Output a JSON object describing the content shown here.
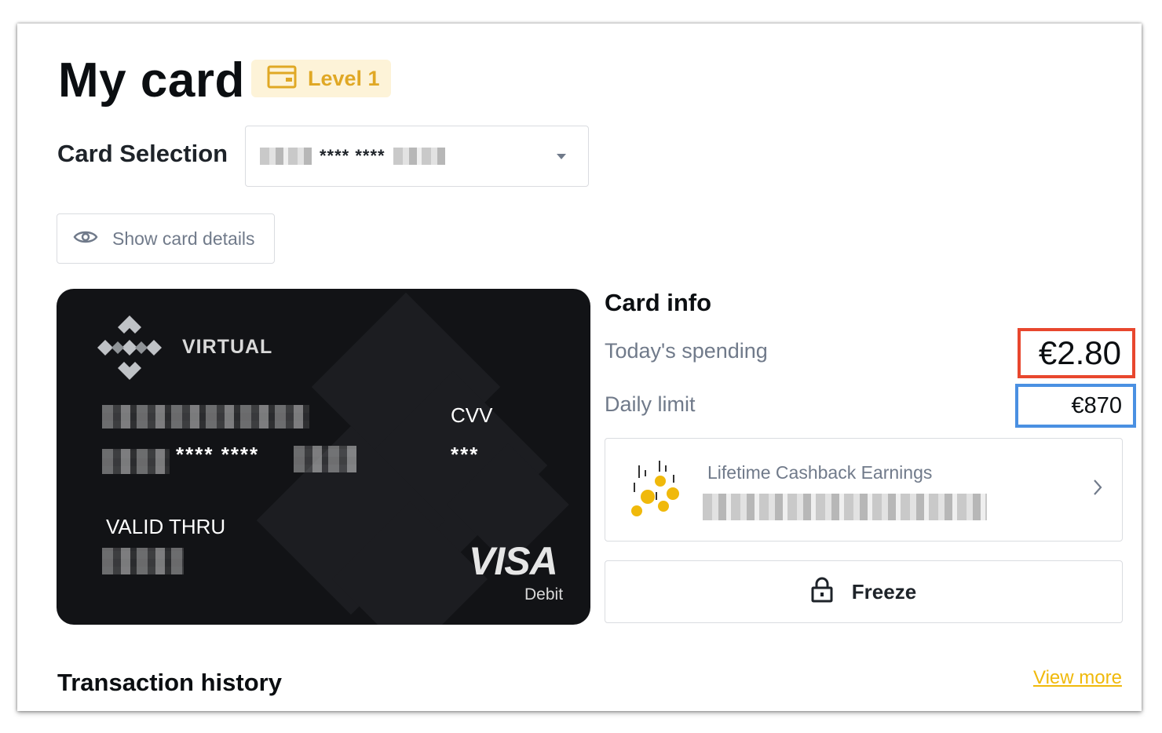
{
  "header": {
    "title": "My card",
    "level_badge": "Level 1"
  },
  "card_selection": {
    "label": "Card Selection",
    "selected_masked": "**** ****"
  },
  "show_details": {
    "label": "Show card details"
  },
  "card": {
    "type_label": "VIRTUAL",
    "cvv_label": "CVV",
    "cvv_value": "***",
    "number_masked": "**** ****",
    "valid_thru_label": "VALID THRU",
    "network": "VISA",
    "network_sub": "Debit"
  },
  "card_info": {
    "title": "Card info",
    "todays_spending_label": "Today's spending",
    "todays_spending_value": "€2.80",
    "daily_limit_label": "Daily limit",
    "daily_limit_value": "€870",
    "cashback_label": "Lifetime Cashback Earnings",
    "freeze_label": "Freeze"
  },
  "transactions": {
    "title": "Transaction history",
    "view_more": "View more"
  },
  "colors": {
    "brand_yellow": "#f0b90b",
    "highlight_red": "#e8472e",
    "highlight_blue": "#4a90e2",
    "card_bg": "#121316"
  },
  "icons": [
    "card-icon",
    "chevron-down-icon",
    "eye-icon",
    "binance-logo-icon",
    "coins-icon",
    "chevron-right-icon",
    "lock-icon"
  ]
}
